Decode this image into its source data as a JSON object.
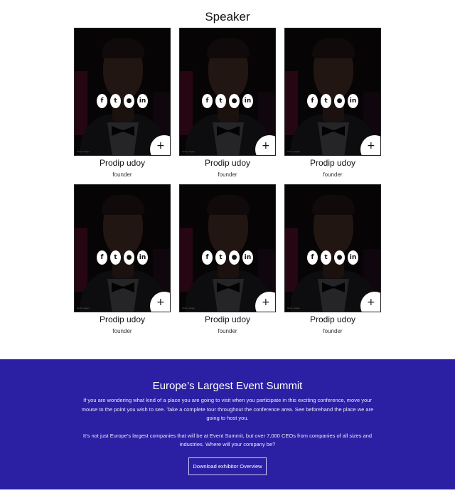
{
  "speakers": {
    "title": "Speaker",
    "cards": [
      {
        "name": "Prodip udoy",
        "role": "founder",
        "credit": "Getty Images"
      },
      {
        "name": "Prodip udoy",
        "role": "founder",
        "credit": "Getty Images"
      },
      {
        "name": "Prodip udoy",
        "role": "founder",
        "credit": "Getty Images"
      },
      {
        "name": "Prodip udoy",
        "role": "founder",
        "credit": "Getty Images"
      },
      {
        "name": "Prodip udoy",
        "role": "founder",
        "credit": "Getty Images"
      },
      {
        "name": "Prodip udoy",
        "role": "founder",
        "credit": "Getty Images"
      }
    ],
    "social_icons": {
      "facebook": {
        "glyph": "f",
        "icon": "facebook-icon"
      },
      "twitter": {
        "glyph": "t",
        "icon": "twitter-icon"
      },
      "github": {
        "glyph": "●",
        "icon": "github-icon"
      },
      "linkedin": {
        "glyph": "in",
        "icon": "linkedin-icon"
      }
    },
    "plus_glyph": "+"
  },
  "summit": {
    "title": "Europe’s Largest Event Summit",
    "paragraph1": "If you are wondering what kind of a place you are going to visit when you participate in this exciting conference, move your mouse to the point you wish to see. Take a complete tour throughout the conference area. See beforehand the place we are going to host you.",
    "paragraph2": "It’s not just Europe’s largest companies that will be at Event Summit, but over 7,000 CEOs from companies of all sizes and industries. Where will your company be?",
    "button_label": "Download exhibitor Overview",
    "background_color": "#2b1fa3"
  }
}
